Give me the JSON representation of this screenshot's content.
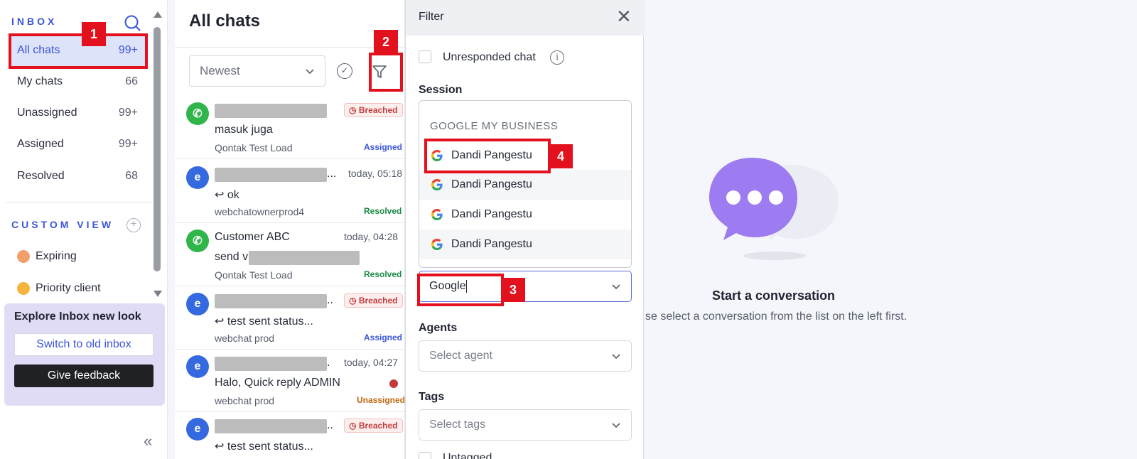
{
  "sidebar": {
    "inbox_heading": "INBOX",
    "items": [
      {
        "label": "All chats",
        "count": "99+"
      },
      {
        "label": "My chats",
        "count": "66"
      },
      {
        "label": "Unassigned",
        "count": "99+"
      },
      {
        "label": "Assigned",
        "count": "99+"
      },
      {
        "label": "Resolved",
        "count": "68"
      }
    ],
    "custom_view_heading": "CUSTOM VIEW",
    "custom_views": [
      {
        "label": "Expiring",
        "icon": "emoji-face-icon"
      },
      {
        "label": "Priority client",
        "icon": "emoji-face-icon"
      }
    ],
    "explore": {
      "title": "Explore Inbox new look",
      "switch_label": "Switch to old inbox",
      "feedback_label": "Give feedback"
    },
    "collapse_glyph": "«"
  },
  "chatlist": {
    "title": "All chats",
    "sort_value": "Newest",
    "chats": [
      {
        "name": "",
        "time": "",
        "breach": "Breached",
        "message": "masuk juga",
        "source": "Qontak Test Load",
        "status": "Assigned",
        "channel": "whatsapp"
      },
      {
        "name": "...",
        "time": "today, 05:18",
        "breach": "",
        "message": "ok",
        "source": "webchatownerprod4",
        "status": "Resolved",
        "channel": "webchat"
      },
      {
        "name": "Customer ABC",
        "time": "today, 04:28",
        "breach": "",
        "message": "send v",
        "source": "Qontak Test Load",
        "status": "Resolved",
        "channel": "whatsapp"
      },
      {
        "name": "..",
        "time": "",
        "breach": "Breached",
        "message": "test sent status...",
        "source": "webchat prod",
        "status": "Assigned",
        "channel": "webchat"
      },
      {
        "name": ".",
        "time": "today, 04:27",
        "breach": "",
        "message": "Halo, Quick reply ADMIN",
        "source": "webchat prod",
        "status": "Unassigned",
        "channel": "webchat"
      },
      {
        "name": "..",
        "time": "",
        "breach": "Breached",
        "message": "test sent status...",
        "source": "",
        "status": "",
        "channel": "webchat"
      }
    ]
  },
  "filter": {
    "title": "Filter",
    "unresponded_label": "Unresponded chat",
    "session_label": "Session",
    "session_group": "GOOGLE MY BUSINESS",
    "session_options": [
      "Dandi Pangestu",
      "Dandi Pangestu",
      "Dandi Pangestu",
      "Dandi Pangestu"
    ],
    "session_input_value": "Google",
    "agents_label": "Agents",
    "agents_placeholder": "Select agent",
    "tags_label": "Tags",
    "tags_placeholder": "Select tags",
    "untagged_label": "Untagged"
  },
  "empty_state": {
    "title": "Start a conversation",
    "subtitle": "se select a conversation from the list on the left first."
  },
  "annotations": [
    "1",
    "2",
    "3",
    "4"
  ],
  "colors": {
    "accent": "#3b55d9",
    "annotation": "#e3101d",
    "whatsapp": "#2fb54a",
    "webchat": "#3569e0",
    "bubble": "#9d7bf0"
  }
}
